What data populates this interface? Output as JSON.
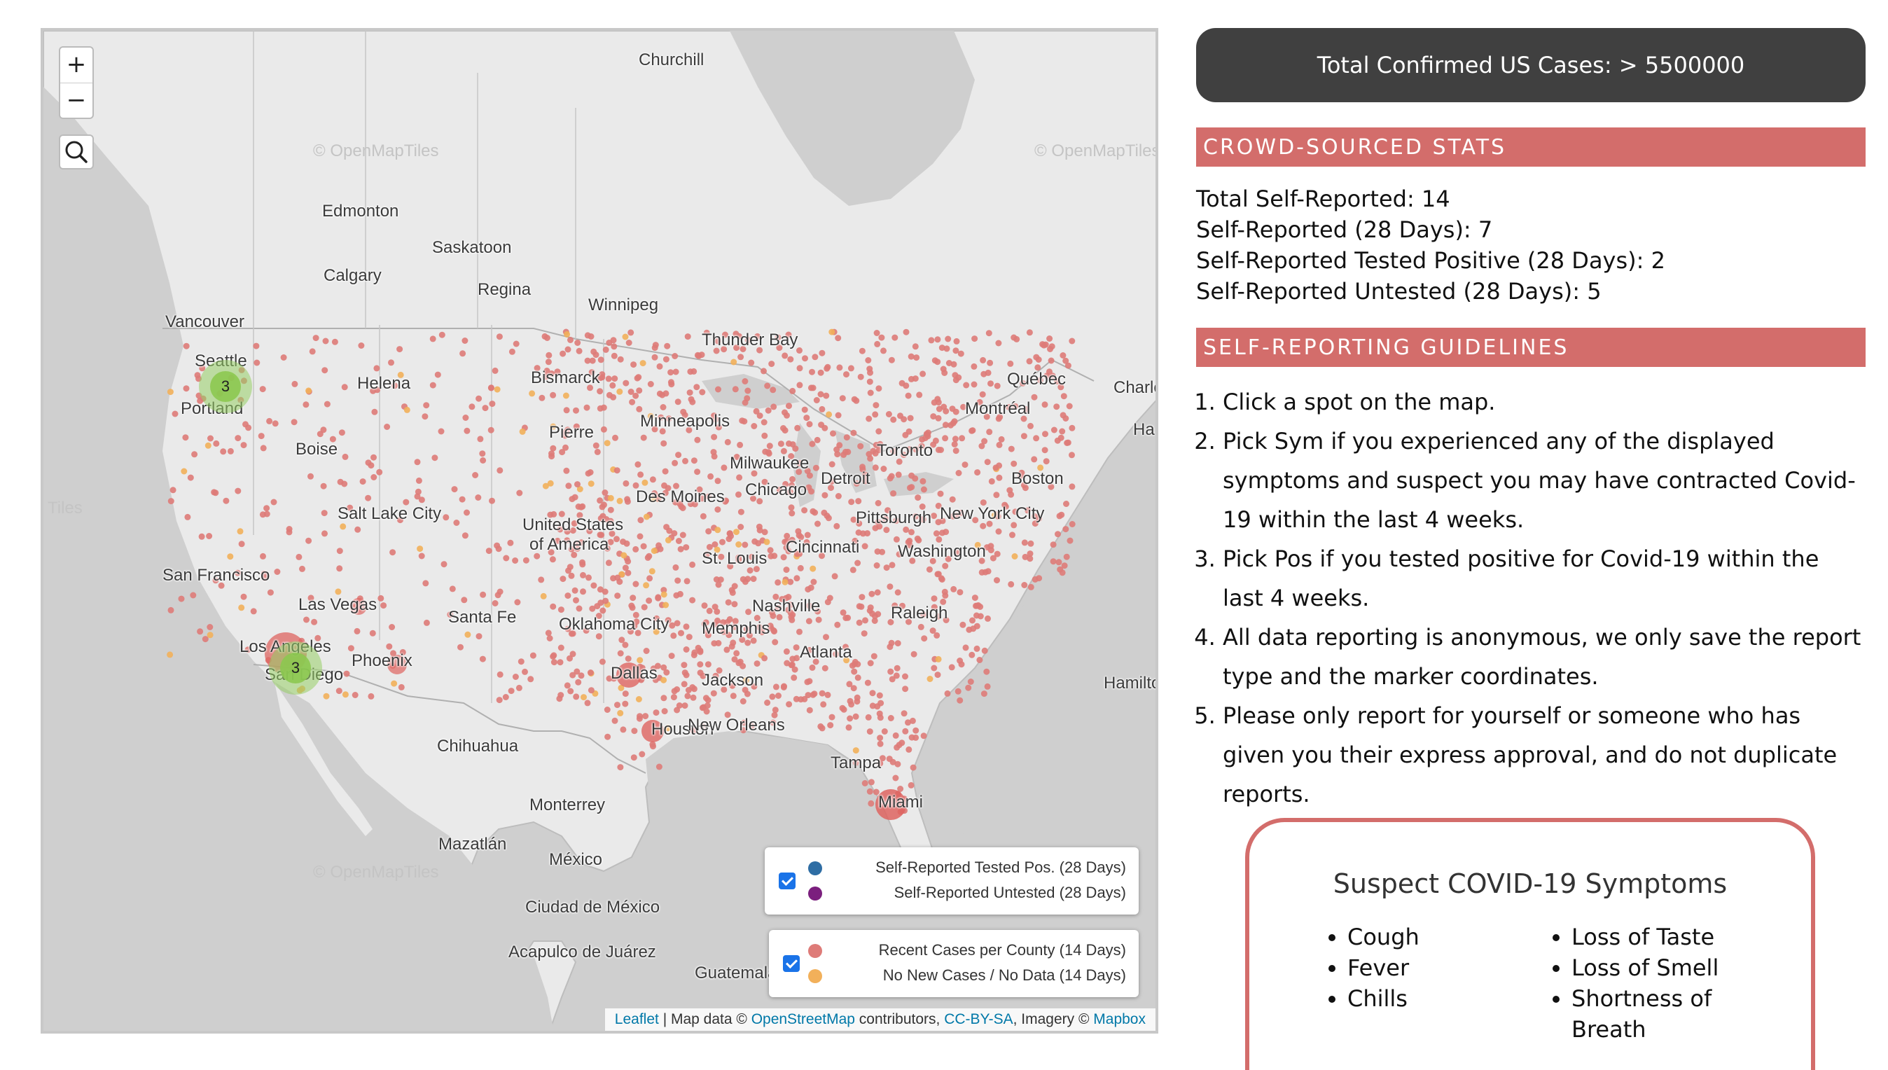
{
  "map": {
    "zoom_in": "+",
    "zoom_out": "−",
    "tile_watermark": "© OpenMapTiles",
    "tile_watermark_short": "Tiles",
    "cities": [
      "Churchill",
      "Edmonton",
      "Saskatoon",
      "Calgary",
      "Regina",
      "Winnipeg",
      "Vancouver",
      "Seattle",
      "Portland",
      "Helena",
      "Bismarck",
      "Thunder Bay",
      "Québec",
      "Montréal",
      "Boise",
      "Pierre",
      "Minneapolis",
      "Toronto",
      "Milwaukee",
      "Detroit",
      "Chicago",
      "Boston",
      "Salt Lake City",
      "United States",
      "of America",
      "Des Moines",
      "Pittsburgh",
      "New York City",
      "San Francisco",
      "St. Louis",
      "Cincinnati",
      "Washington",
      "Las Vegas",
      "Santa Fe",
      "Oklahoma City",
      "Nashville",
      "Raleigh",
      "Los Angeles",
      "Phoenix",
      "San Diego",
      "Dallas",
      "Memphis",
      "Atlanta",
      "Jackson",
      "Houston",
      "New Orleans",
      "Tampa",
      "Miami",
      "Chihuahua",
      "Monterrey",
      "Mazatlán",
      "México",
      "Ciudad de México",
      "Acapulco de Juárez",
      "Guatemala",
      "Hamilton",
      "Charlo",
      "Ha"
    ],
    "clusters": [
      {
        "label": "3"
      },
      {
        "label": "3"
      }
    ],
    "legend_top": {
      "checked": true,
      "rows": [
        {
          "label": "Self-Reported Tested Pos. (28 Days)",
          "color": "#2e6da4"
        },
        {
          "label": "Self-Reported Untested (28 Days)",
          "color": "#7b1f7e"
        }
      ]
    },
    "legend_bottom": {
      "checked": true,
      "rows": [
        {
          "label": "Recent Cases per County (14 Days)",
          "color": "#de7b78"
        },
        {
          "label": "No New Cases / No Data (14 Days)",
          "color": "#f2b05a"
        }
      ]
    },
    "attribution": {
      "leaflet": "Leaflet",
      "sep1": " | Map data © ",
      "osm": "OpenStreetMap",
      "sep2": " contributors, ",
      "license": "CC-BY-SA",
      "sep3": ", Imagery © ",
      "mapbox": "Mapbox"
    }
  },
  "panel": {
    "total_cases": "Total Confirmed US Cases: > 5500000",
    "crowd_heading": "CROWD-SOURCED STATS",
    "stats": [
      {
        "label": "Total Self-Reported: ",
        "value": "14"
      },
      {
        "label": "Self-Reported (28 Days): ",
        "value": "7"
      },
      {
        "label": "Self-Reported Tested Positive (28 Days): ",
        "value": "2"
      },
      {
        "label": "Self-Reported Untested (28 Days): ",
        "value": "5"
      }
    ],
    "guide_heading": "SELF-REPORTING GUIDELINES",
    "guidelines": [
      "Click a spot on the map.",
      "Pick Sym if you experienced any of the displayed symptoms and suspect you may have contracted Covid-19 within the last 4 weeks.",
      "Pick Pos if you tested positive for Covid-19 within the last 4 weeks.",
      "All data reporting is anonymous, we only save the report type and the marker coordinates.",
      "Please only report for yourself or someone who has given you their express approval, and do not duplicate reports."
    ],
    "symptoms_title": "Suspect COVID-19 Symptoms",
    "symptoms_left": [
      "Cough",
      "Fever",
      "Chills"
    ],
    "symptoms_right": [
      "Loss of Taste",
      "Loss of Smell",
      "Shortness of Breath"
    ]
  }
}
